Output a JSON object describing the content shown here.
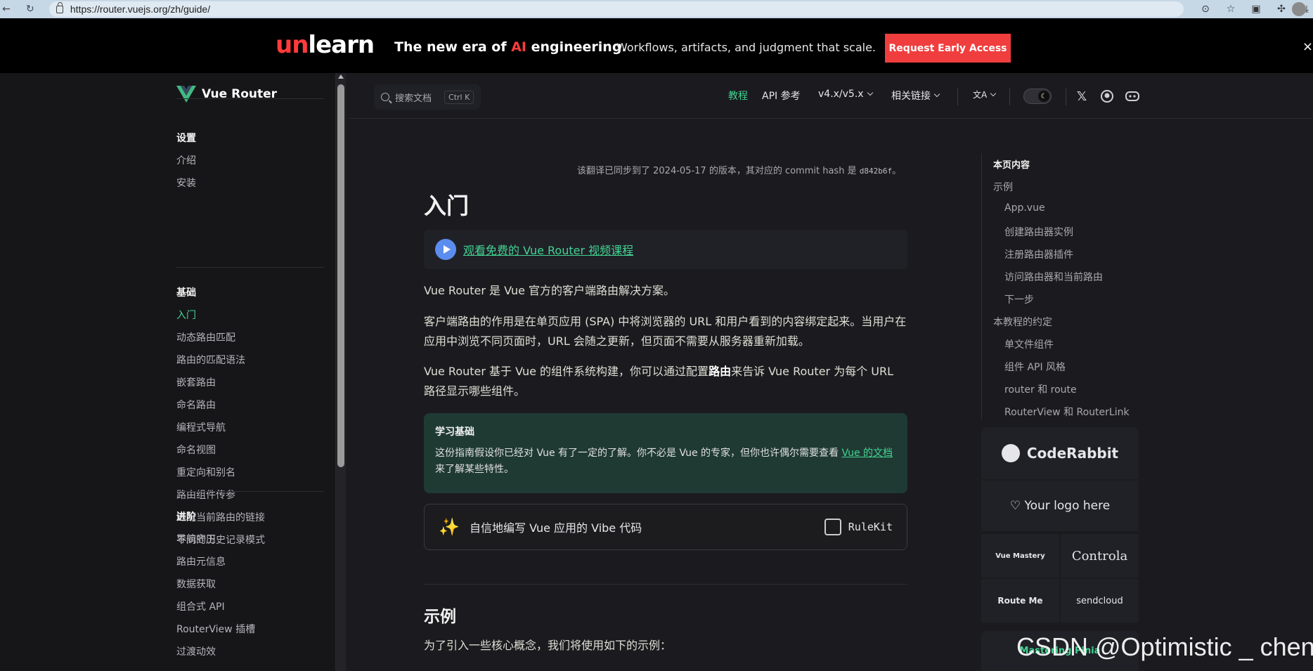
{
  "browser": {
    "url": "https://router.vuejs.org/zh/guide/"
  },
  "banner": {
    "logo_un": "un",
    "logo_learn": "learn",
    "headline_a": "The new era of ",
    "headline_ai": "AI",
    "headline_b": " engineering.",
    "subtext": "Workflows, artifacts, and judgment that scale.",
    "cta": "Request Early Access",
    "close": "×"
  },
  "sidebar": {
    "brand": "Vue Router",
    "groups": [
      {
        "title": "设置",
        "items": [
          "介绍",
          "安装"
        ]
      },
      {
        "title": "基础",
        "items": [
          "入门",
          "动态路由匹配",
          "路由的匹配语法",
          "嵌套路由",
          "命名路由",
          "编程式导航",
          "命名视图",
          "重定向和别名",
          "路由组件传参",
          "匹配当前路由的链接",
          "不同的历史记录模式"
        ]
      },
      {
        "title": "进阶",
        "items": [
          "导航守卫",
          "路由元信息",
          "数据获取",
          "组合式 API",
          "RouterView 插槽",
          "过渡动效"
        ]
      }
    ],
    "active": "入门"
  },
  "topnav": {
    "search_placeholder": "搜索文档",
    "search_kbd": "Ctrl K",
    "links": [
      "教程",
      "API 参考",
      "v4.x/v5.x",
      "相关链接"
    ],
    "translate_icon": "文A"
  },
  "main": {
    "sync_note_a": "该翻译已同步到了 2024-05-17 的版本，其对应的 commit hash 是 ",
    "sync_hash": "d842b6f",
    "sync_note_b": "。",
    "title": "入门",
    "course_link": "观看免费的 Vue Router 视频课程",
    "p1": "Vue Router 是 Vue 官方的客户端路由解决方案。",
    "p2": "客户端路由的作用是在单页应用 (SPA) 中将浏览器的 URL 和用户看到的内容绑定起来。当用户在应用中浏览不同页面时，URL 会随之更新，但页面不需要从服务器重新加载。",
    "p3_a": "Vue Router 基于 Vue 的组件系统构建，你可以通过配置",
    "p3_bold": "路由",
    "p3_b": "来告诉 Vue Router 为每个 URL 路径显示哪些组件。",
    "tip_title": "学习基础",
    "tip_body_a": "这份指南假设你已经对 Vue 有了一定的了解。你不必是 Vue 的专家，但你也许偶尔需要查看 ",
    "tip_link": "Vue 的文档",
    "tip_body_b": "来了解某些特性。",
    "vibe_text": "自信地编写 Vue 应用的 Vibe 代码",
    "rulekit": "RuleKit",
    "h2": "示例",
    "p4": "为了引入一些核心概念，我们将使用如下的示例："
  },
  "toc": {
    "title": "本页内容",
    "items": [
      {
        "label": "示例",
        "level": 1
      },
      {
        "label": "App.vue",
        "level": 2
      },
      {
        "label": "创建路由器实例",
        "level": 2
      },
      {
        "label": "注册路由器插件",
        "level": 2
      },
      {
        "label": "访问路由器和当前路由",
        "level": 2
      },
      {
        "label": "下一步",
        "level": 2
      },
      {
        "label": "本教程的约定",
        "level": 1
      },
      {
        "label": "单文件组件",
        "level": 2
      },
      {
        "label": "组件 API 风格",
        "level": 2
      },
      {
        "label": "router 和 route",
        "level": 2
      },
      {
        "label": "RouterView 和 RouterLink",
        "level": 2
      }
    ]
  },
  "sponsors": {
    "coderabbit": "CodeRabbit",
    "your_logo": "♡ Your logo here",
    "vuemastery": "Vue Mastery",
    "controla": "Controla",
    "routeme": "Route Me",
    "sendcloud": "sendcloud",
    "mastering_pinia": "Mastering Pinia"
  },
  "watermark": "CSDN @Optimistic _ chen",
  "colors": {
    "accent": "#42d392",
    "banner_red": "#f03e3e",
    "bg": "#1b1b1f",
    "tip_bg": "#1f3a33"
  }
}
